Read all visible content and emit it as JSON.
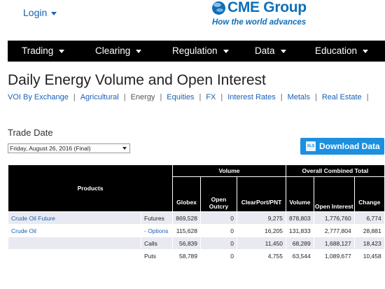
{
  "header": {
    "login_label": "Login",
    "logo_text": "CME Group",
    "tagline": "How the world advances"
  },
  "nav": {
    "items": [
      {
        "label": "Trading"
      },
      {
        "label": "Clearing"
      },
      {
        "label": "Regulation"
      },
      {
        "label": "Data"
      },
      {
        "label": "Education"
      }
    ]
  },
  "page": {
    "title": "Daily Energy Volume and Open Interest"
  },
  "subnav": {
    "items": [
      {
        "label": "VOI By Exchange"
      },
      {
        "label": "Agricultural"
      },
      {
        "label": "Energy"
      },
      {
        "label": "Equities"
      },
      {
        "label": "FX"
      },
      {
        "label": "Interest Rates"
      },
      {
        "label": "Metals"
      },
      {
        "label": "Real Estate"
      }
    ],
    "separator": "|"
  },
  "trade_date": {
    "label": "Trade Date",
    "selected": "Friday, August 26, 2016 (Final)"
  },
  "download": {
    "icon_text": "XLS",
    "label": "Download Data"
  },
  "table": {
    "products_header": "Products",
    "volume_header": "Volume",
    "combined_header": "Overall Combined Total",
    "columns": [
      "Globex",
      "Open Outcry",
      "ClearPort/PNT",
      "Volume",
      "Open Interest",
      "Change"
    ],
    "rows": [
      {
        "product": "Crude Oil Future",
        "type": "Futures",
        "globex": "869,528",
        "outcry": "0",
        "clearport": "9,275",
        "volume": "878,803",
        "oi": "1,776,760",
        "change": "6,774"
      },
      {
        "product": "Crude Oil",
        "type": "- Options",
        "globex": "115,628",
        "outcry": "0",
        "clearport": "16,205",
        "volume": "131,833",
        "oi": "2,777,804",
        "change": "28,881"
      },
      {
        "product": "",
        "type": "Calls",
        "globex": "56,839",
        "outcry": "0",
        "clearport": "11,450",
        "volume": "68,289",
        "oi": "1,688,127",
        "change": "18,423"
      },
      {
        "product": "",
        "type": "Puts",
        "globex": "58,789",
        "outcry": "0",
        "clearport": "4,755",
        "volume": "63,544",
        "oi": "1,089,677",
        "change": "10,458"
      }
    ]
  },
  "colors": {
    "brand_blue": "#0d6fb8",
    "link_blue": "#1a5fb4",
    "nav_bg": "#000000",
    "button_bg": "#1b8fe0",
    "row_shade": "#e9eaf1"
  }
}
